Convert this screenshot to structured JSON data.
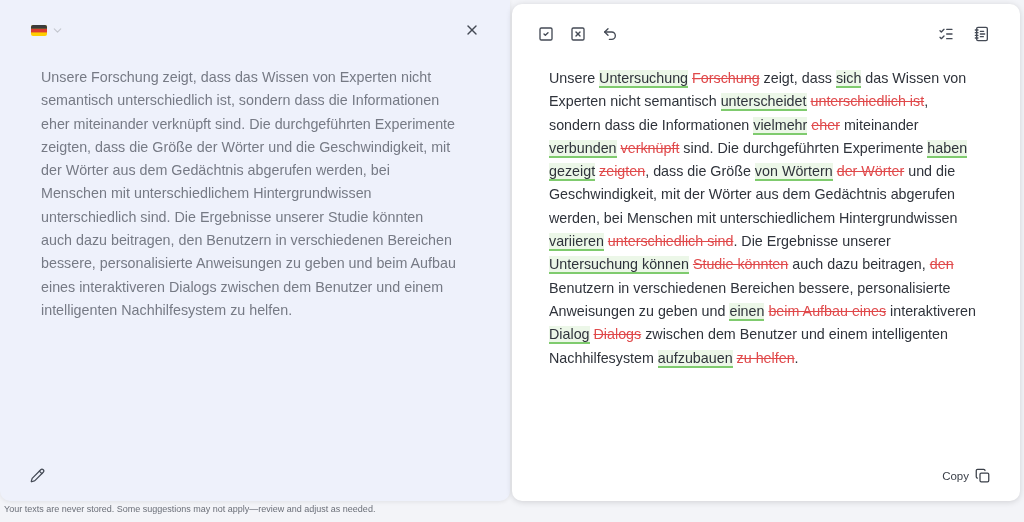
{
  "source_panel": {
    "text": "Unsere Forschung zeigt, dass das Wissen von Experten nicht semantisch unterschiedlich ist, sondern dass die Informationen eher miteinander verknüpft sind. Die durchgeführten Experimente zeigten, dass die Größe der Wörter und die Geschwindigkeit, mit der Wörter aus dem Gedächtnis abgerufen werden, bei Menschen mit unterschiedlichem Hintergrundwissen unterschiedlich sind. Die Ergebnisse unserer Studie könnten auch dazu beitragen, den Benutzern in verschiedenen Bereichen bessere, personalisierte Anweisungen zu geben und beim Aufbau eines interaktiveren Dialogs zwischen dem Benutzer und einem intelligenten Nachhilfesystem zu helfen."
  },
  "result_panel": {
    "segments": [
      {
        "kind": "plain",
        "text": "Unsere "
      },
      {
        "kind": "insert",
        "text": "Untersuchung"
      },
      {
        "kind": "delete",
        "text": "Forschung"
      },
      {
        "kind": "plain",
        "text": " zeigt, dass "
      },
      {
        "kind": "insert",
        "text": "sich"
      },
      {
        "kind": "plain",
        "text": " das Wissen von Experten nicht semantisch "
      },
      {
        "kind": "insert",
        "text": "unterscheidet"
      },
      {
        "kind": "delete",
        "text": "unterschiedlich ist"
      },
      {
        "kind": "plain",
        "text": ", sondern dass die Informationen "
      },
      {
        "kind": "insert",
        "text": "vielmehr"
      },
      {
        "kind": "delete",
        "text": "eher"
      },
      {
        "kind": "plain",
        "text": " miteinander "
      },
      {
        "kind": "insert",
        "text": "verbunden"
      },
      {
        "kind": "delete",
        "text": "verknüpft"
      },
      {
        "kind": "plain",
        "text": " sind. Die durchgeführten Experimente "
      },
      {
        "kind": "insert",
        "text": "haben gezeigt"
      },
      {
        "kind": "delete",
        "text": "zeigten"
      },
      {
        "kind": "plain",
        "text": ", dass die Größe "
      },
      {
        "kind": "insert",
        "text": "von Wörtern"
      },
      {
        "kind": "delete",
        "text": "der Wörter"
      },
      {
        "kind": "plain",
        "text": " und die Geschwindigkeit, mit der Wörter aus dem Gedächtnis abgerufen werden, bei Menschen mit unterschiedlichem Hintergrundwissen "
      },
      {
        "kind": "insert",
        "text": "variieren"
      },
      {
        "kind": "delete",
        "text": "unterschiedlich sind"
      },
      {
        "kind": "plain",
        "text": ". Die Ergebnisse unserer "
      },
      {
        "kind": "insert",
        "text": "Untersuchung können"
      },
      {
        "kind": "delete",
        "text": "Studie könnten"
      },
      {
        "kind": "plain",
        "text": " auch dazu beitragen, "
      },
      {
        "kind": "delete",
        "text": "den"
      },
      {
        "kind": "plain",
        "text": " Benutzern in verschiedenen Bereichen bessere, personalisierte Anweisungen zu geben und "
      },
      {
        "kind": "insert",
        "text": "einen"
      },
      {
        "kind": "delete",
        "text": "beim Aufbau eines"
      },
      {
        "kind": "plain",
        "text": " interaktiveren "
      },
      {
        "kind": "insert",
        "text": "Dialog"
      },
      {
        "kind": "delete",
        "text": "Dialogs"
      },
      {
        "kind": "plain",
        "text": " zwischen dem Benutzer und einem intelligenten Nachhilfesystem "
      },
      {
        "kind": "insert",
        "text": "aufzubauen"
      },
      {
        "kind": "delete",
        "text": "zu helfen"
      },
      {
        "kind": "plain",
        "text": "."
      }
    ],
    "copy_button": "Copy"
  },
  "footer_note": "Your texts are never stored. Some suggestions may not apply—review and adjust as needed."
}
